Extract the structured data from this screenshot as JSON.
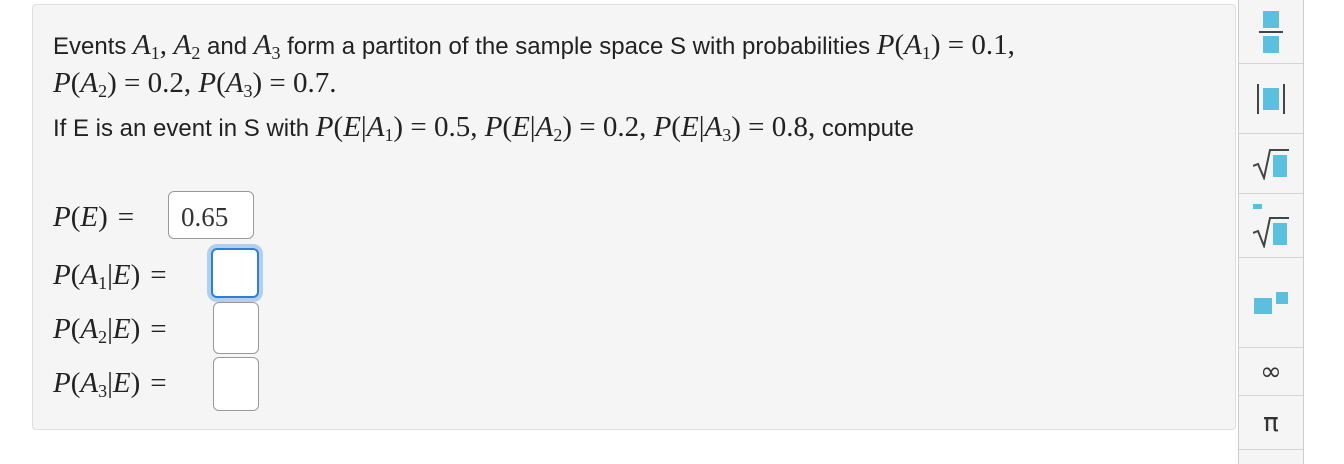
{
  "question": {
    "line1_prefix": "Events",
    "line1_and": "and",
    "line1_mid": "form a partiton of the sample space S with probabilities",
    "line3_prefix": "If E is an event in S with",
    "line3_suffix": "compute",
    "given_probs": {
      "A1": "0.1",
      "A2": "0.2",
      "A3": "0.7"
    },
    "conditional_probs": {
      "E_given_A1": "0.5",
      "E_given_A2": "0.2",
      "E_given_A3": "0.8"
    }
  },
  "answers": [
    {
      "label": "P(E)",
      "value": "0.65"
    },
    {
      "label": "P(A1|E)",
      "value": ""
    },
    {
      "label": "P(A2|E)",
      "value": ""
    },
    {
      "label": "P(A3|E)",
      "value": ""
    }
  ],
  "toolbar": {
    "tools": [
      "fraction-icon",
      "absolute-value-icon",
      "square-root-icon",
      "nth-root-icon",
      "exponent-icon",
      "infinity-icon",
      "pi-icon"
    ],
    "infinity_symbol": "∞",
    "pi_symbol": "π"
  },
  "colors": {
    "accent": "#5bc0de",
    "focus": "#2e7fd6"
  }
}
